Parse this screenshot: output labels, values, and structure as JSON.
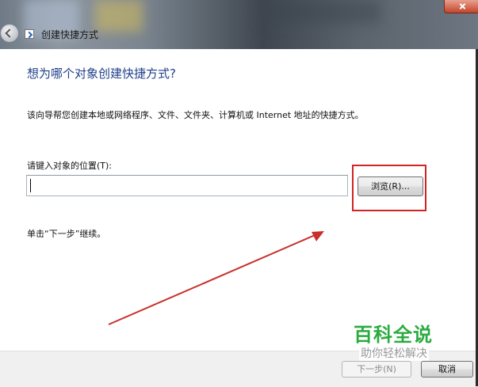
{
  "window": {
    "title": "创建快捷方式"
  },
  "wizard": {
    "heading": "想为哪个对象创建快捷方式?",
    "description": "该向导帮您创建本地或网络程序、文件、文件夹、计算机或 Internet 地址的快捷方式。",
    "location_label": "请键入对象的位置(T):",
    "location_value": "",
    "browse_label": "浏览(R)...",
    "hint": "单击“下一步”继续。"
  },
  "footer": {
    "next_label": "下一步(N)",
    "cancel_label": "取消"
  },
  "watermark": {
    "title": "百科全说",
    "subtitle": "助你轻松解决"
  },
  "colors": {
    "heading": "#1f3f8a",
    "annotation": "#d22424",
    "watermark": "#2bab3f"
  }
}
